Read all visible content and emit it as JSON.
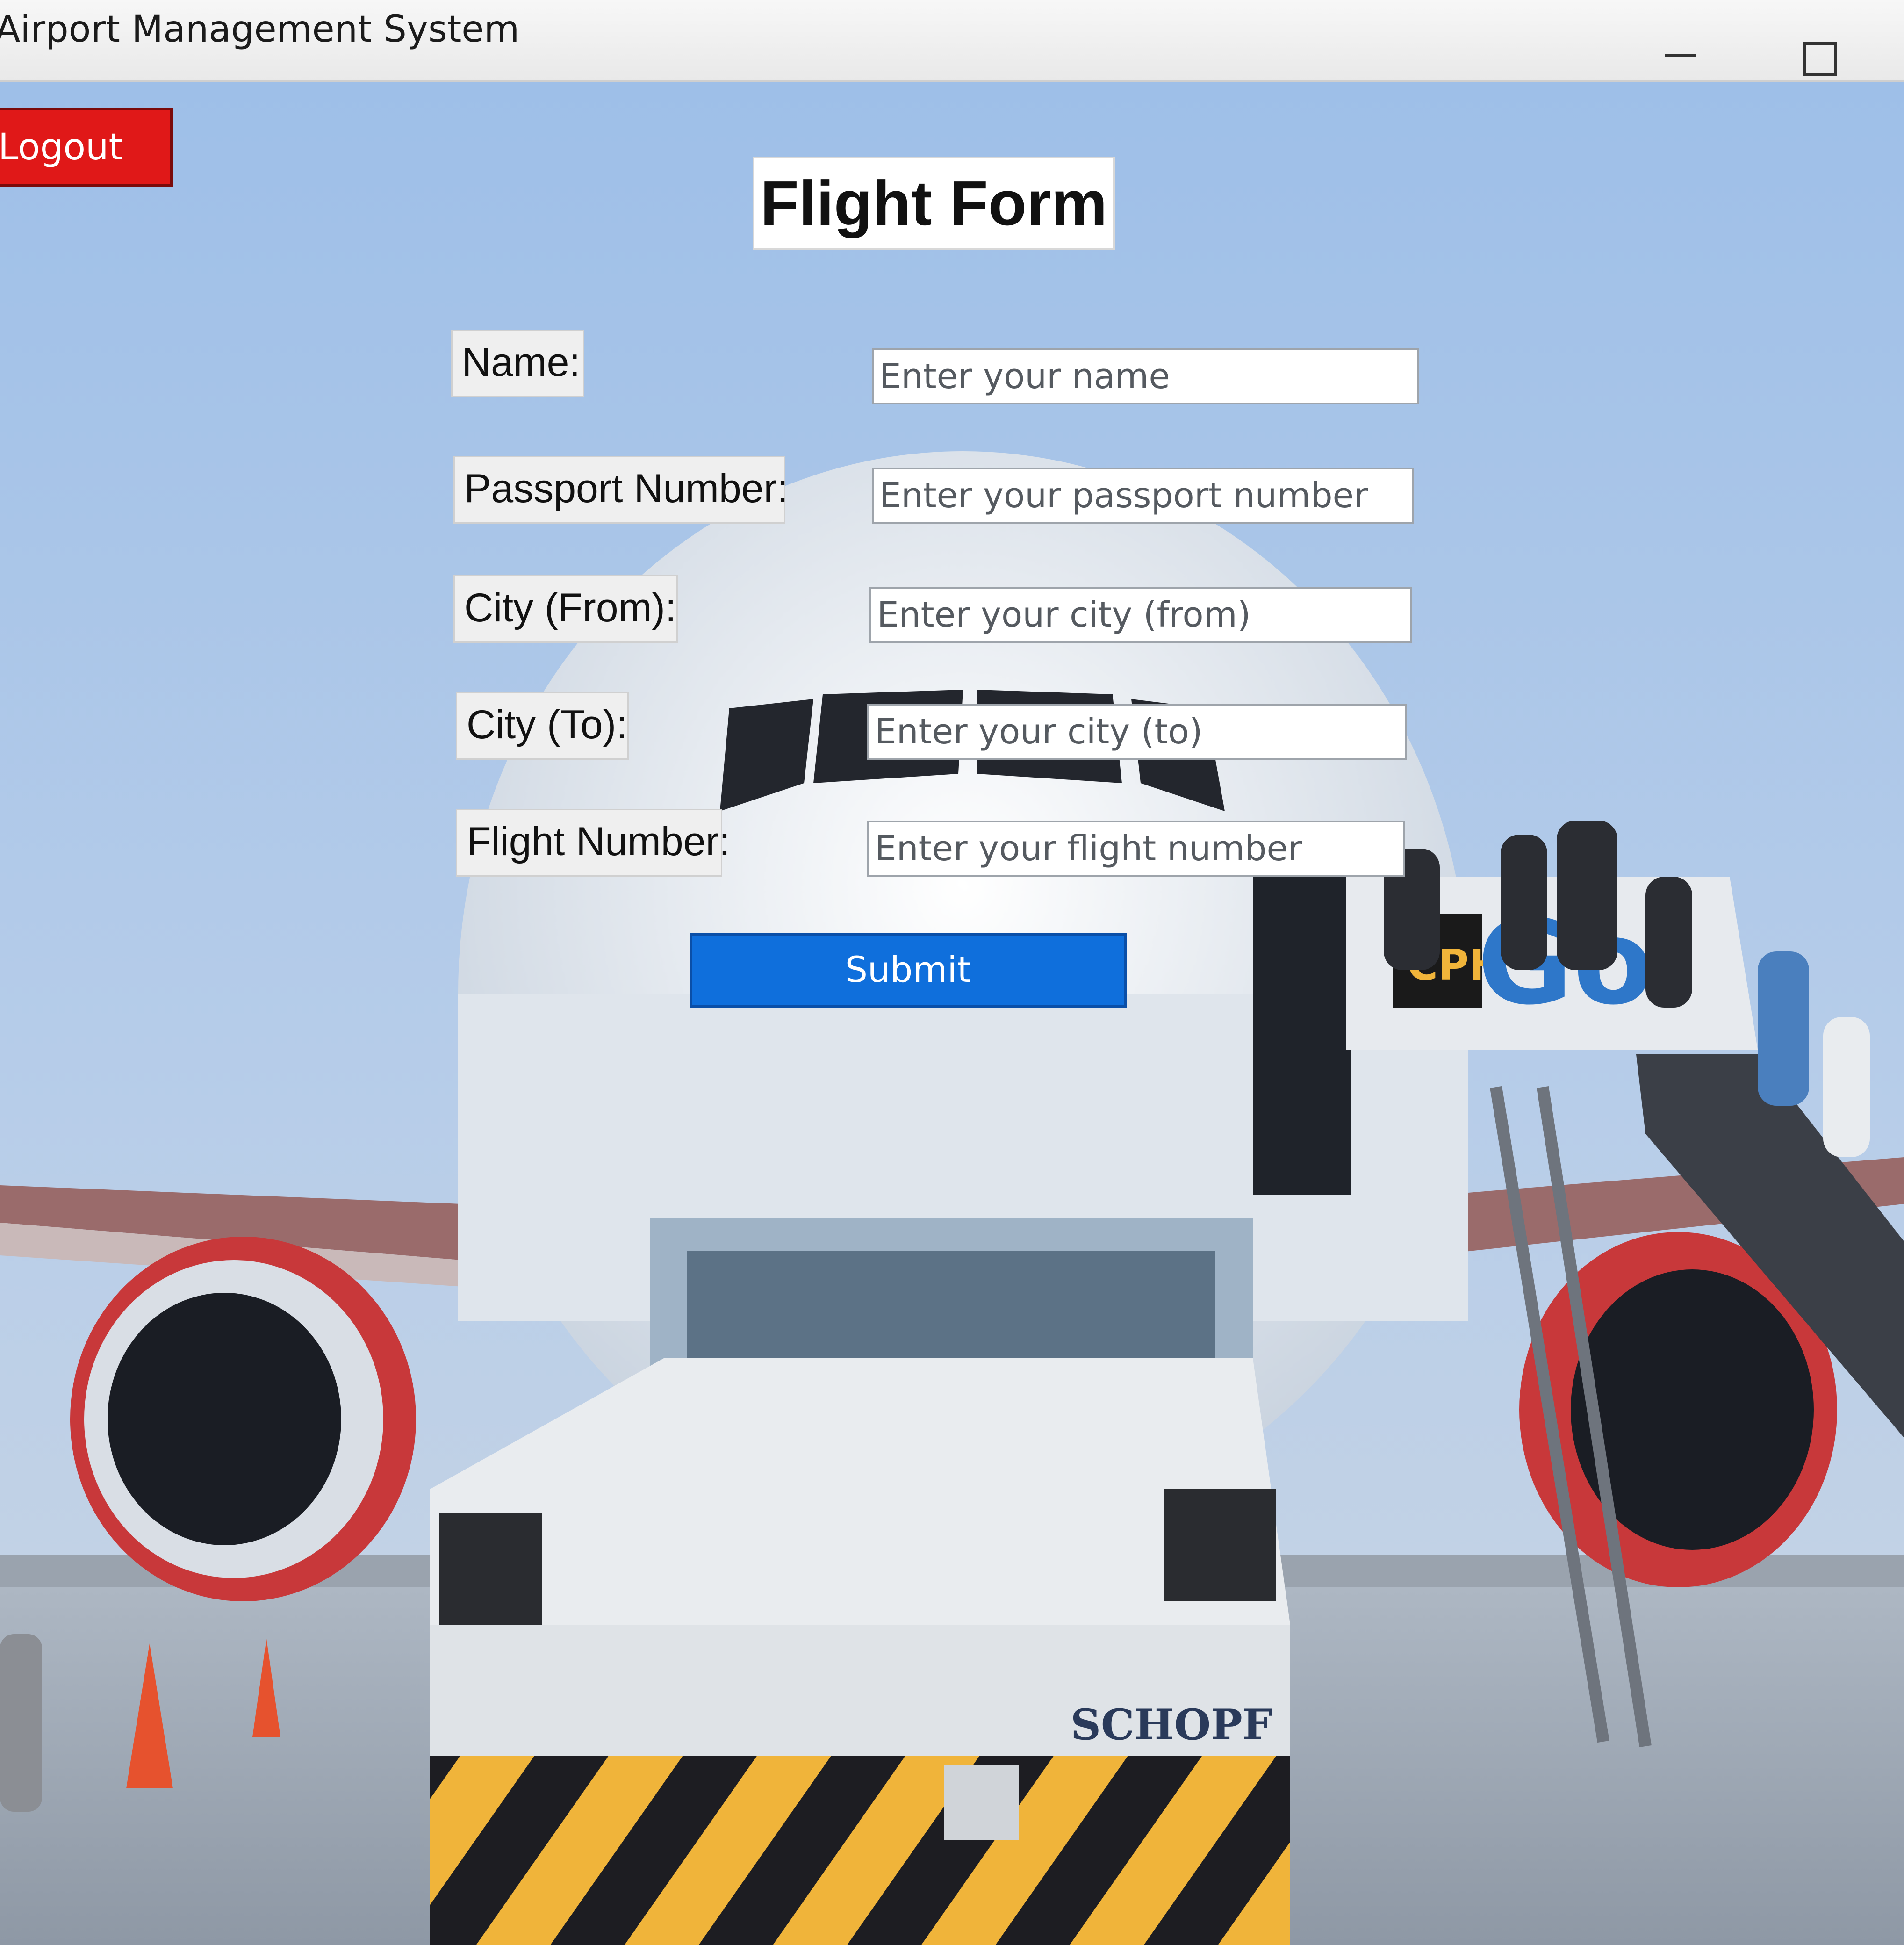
{
  "window": {
    "title": "Airport Management System"
  },
  "header": {
    "logout_label": "Logout",
    "form_title": "Flight Form"
  },
  "form": {
    "fields": [
      {
        "label": "Name:",
        "placeholder": "Enter your name",
        "value": ""
      },
      {
        "label": "Passport Number:",
        "placeholder": "Enter your passport number",
        "value": ""
      },
      {
        "label": "City (From):",
        "placeholder": "Enter your city (from)",
        "value": ""
      },
      {
        "label": "City (To):",
        "placeholder": "Enter your city (to)",
        "value": ""
      },
      {
        "label": "Flight Number:",
        "placeholder": "Enter your flight number",
        "value": ""
      }
    ],
    "submit_label": "Submit"
  },
  "background": {
    "stair_truck_brand": "Go",
    "stair_truck_badge": "CPH",
    "tug_brand": "SCHOPF"
  },
  "colors": {
    "logout_bg": "#e01818",
    "submit_bg": "#0f6fdc",
    "sky": "#a9c3e6"
  }
}
